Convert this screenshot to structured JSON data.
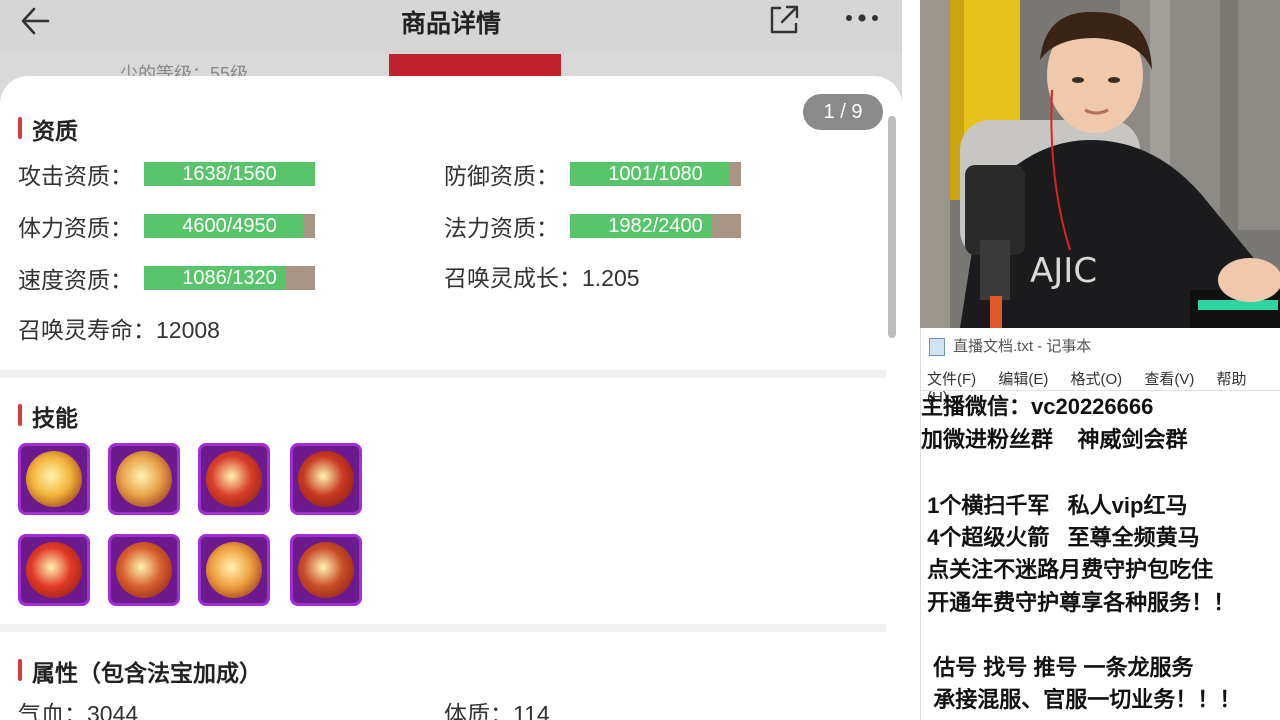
{
  "app": {
    "title": "商品详情",
    "pager": "1 / 9",
    "partial_text": "少的等级：55级"
  },
  "sections": {
    "aptitude": "资质",
    "skills": "技能",
    "attributes": "属性（包含法宝加成）"
  },
  "aptitude_bars": [
    {
      "label": "攻击资质：",
      "value": "1638/1560",
      "fill": 1.0
    },
    {
      "label": "防御资质：",
      "value": "1001/1080",
      "fill": 0.927
    },
    {
      "label": "体力资质：",
      "value": "4600/4950",
      "fill": 0.929
    },
    {
      "label": "法力资质：",
      "value": "1982/2400",
      "fill": 0.826
    },
    {
      "label": "速度资质：",
      "value": "1086/1320",
      "fill": 0.823
    }
  ],
  "growth": {
    "label": "召唤灵成长：",
    "value": "1.205"
  },
  "lifespan": {
    "label": "召唤灵寿命：",
    "value": "12008"
  },
  "attributes": [
    {
      "label": "气血：",
      "value": "3044"
    },
    {
      "label": "体质：",
      "value": "114"
    }
  ],
  "skills": [
    {
      "icon": "skill-axe-fire-icon",
      "color": "#f2b33a"
    },
    {
      "icon": "skill-rabbit-fire-icon",
      "color": "#e8a24a"
    },
    {
      "icon": "skill-demon-fire-icon",
      "color": "#d8402a"
    },
    {
      "icon": "skill-bat-fire-icon",
      "color": "#c83a22"
    },
    {
      "icon": "skill-imp-fire-icon",
      "color": "#e23a26"
    },
    {
      "icon": "skill-warrior-fire-icon",
      "color": "#d9602e"
    },
    {
      "icon": "skill-blade-fire-icon",
      "color": "#f0a040"
    },
    {
      "icon": "skill-mask-fire-icon",
      "color": "#c94e28"
    }
  ],
  "notepad": {
    "title": "直播文档.txt - 记事本",
    "menu": [
      "文件(F)",
      "编辑(E)",
      "格式(O)",
      "查看(V)",
      "帮助(H)"
    ],
    "lines": [
      "主播微信：vc20226666",
      "加微进粉丝群    神威剑会群",
      "",
      " 1个横扫千军   私人vip红马",
      " 4个超级火箭   至尊全频黄马",
      " 点关注不迷路月费守护包吃住",
      " 开通年费守护尊享各种服务！！",
      "",
      "  估号 找号 推号 一条龙服务",
      "  承接混服、官服一切业务！！！"
    ]
  },
  "colors": {
    "accent_red": "#c0222e",
    "bar_fill": "#58c56a",
    "bar_empty": "#a89585",
    "skill_frame": "#a12fd4"
  }
}
